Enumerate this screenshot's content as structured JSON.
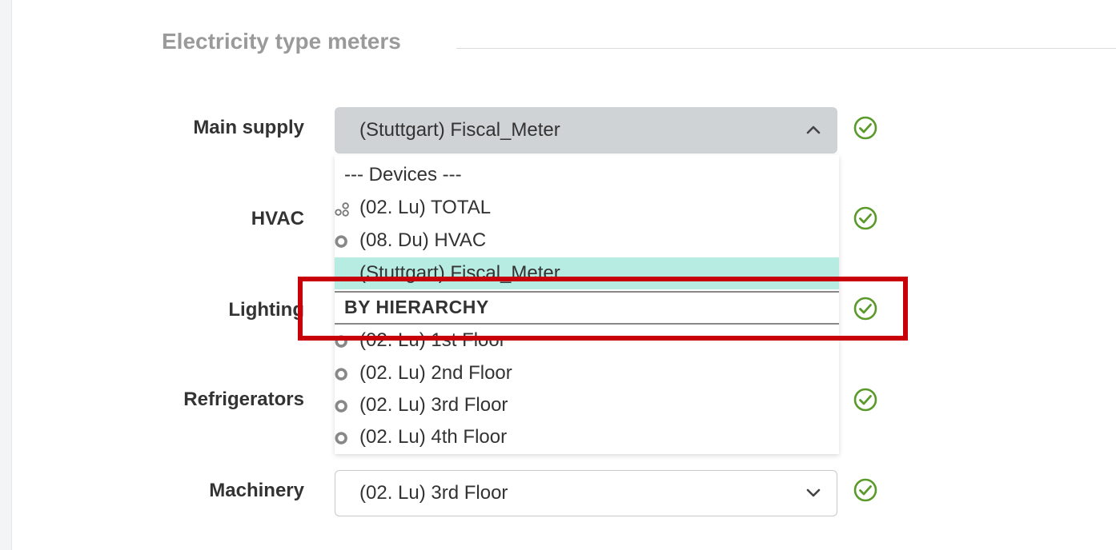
{
  "section": {
    "title": "Electricity type meters"
  },
  "rows": [
    {
      "label": "Main supply",
      "value": "(Stuttgart) Fiscal_Meter",
      "open": true
    },
    {
      "label": "HVAC",
      "value": ""
    },
    {
      "label": "Lighting",
      "value": ""
    },
    {
      "label": "Refrigerators",
      "value": ""
    },
    {
      "label": "Machinery",
      "value": "(02. Lu) 3rd Floor"
    }
  ],
  "dropdown": {
    "devices_header": "--- Devices ---",
    "options": [
      {
        "label": "(02. Lu) TOTAL",
        "icon": "multi-node-icon"
      },
      {
        "label": "(08. Du) HVAC",
        "icon": "ring-node-icon"
      },
      {
        "label": "(Stuttgart) Fiscal_Meter",
        "icon": "",
        "selected": true
      },
      {
        "label": "(02. Lu) 1st Floor",
        "icon": "ring-node-icon"
      },
      {
        "label": "(02. Lu) 2nd Floor",
        "icon": "ring-node-icon"
      },
      {
        "label": "(02. Lu) 3rd Floor",
        "icon": "ring-node-icon"
      },
      {
        "label": "(02. Lu) 4th Floor",
        "icon": "ring-node-icon"
      }
    ],
    "group_header": "BY HIERARCHY"
  },
  "colors": {
    "check_green": "#5a9a2a",
    "selected_bg": "#b7ece3",
    "highlight_red": "#c8000a"
  }
}
